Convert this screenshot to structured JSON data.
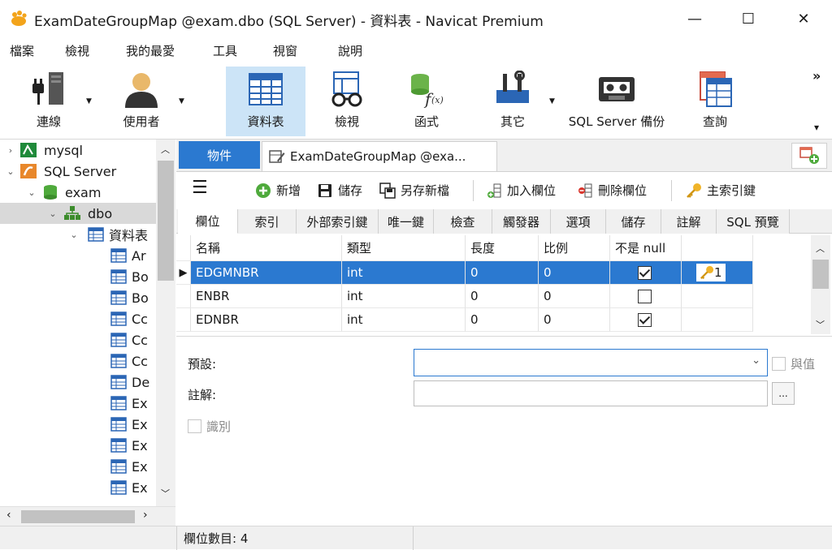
{
  "window": {
    "title": "ExamDateGroupMap @exam.dbo (SQL Server) - 資料表 - Navicat Premium",
    "minimize": "—",
    "maximize": "☐",
    "close": "✕"
  },
  "menu": [
    "檔案",
    "檢視",
    "我的最愛",
    "工具",
    "視窗",
    "說明"
  ],
  "toolbar": {
    "connect": "連線",
    "user": "使用者",
    "table": "資料表",
    "view": "檢視",
    "function": "函式",
    "other": "其它",
    "backup": "SQL Server 備份",
    "query": "查詢",
    "overflow": "»",
    "scroll_down": "▾"
  },
  "tree": {
    "items": [
      {
        "label": "mysql"
      },
      {
        "label": "SQL Server"
      },
      {
        "label": "exam"
      },
      {
        "label": "dbo"
      },
      {
        "label": "資料表"
      },
      {
        "label": "Ar"
      },
      {
        "label": "Bo"
      },
      {
        "label": "Bo"
      },
      {
        "label": "Cc"
      },
      {
        "label": "Cc"
      },
      {
        "label": "Cc"
      },
      {
        "label": "De"
      },
      {
        "label": "Ex"
      },
      {
        "label": "Ex"
      },
      {
        "label": "Ex"
      },
      {
        "label": "Ex"
      },
      {
        "label": "Ex"
      }
    ]
  },
  "tabs": {
    "objects": "物件",
    "design": "ExamDateGroupMap @exa..."
  },
  "design_toolbar": {
    "menu": "☰",
    "new": "新增",
    "save": "儲存",
    "save_as": "另存新檔",
    "add_field": "加入欄位",
    "delete_field": "刪除欄位",
    "primary_key": "主索引鍵"
  },
  "subtabs": [
    "欄位",
    "索引",
    "外部索引鍵",
    "唯一鍵",
    "檢查",
    "觸發器",
    "選項",
    "儲存",
    "註解",
    "SQL 預覽"
  ],
  "grid": {
    "headers": {
      "name": "名稱",
      "type": "類型",
      "length": "長度",
      "scale": "比例",
      "notnull": "不是 null"
    },
    "rows": [
      {
        "name": "EDGMNBR",
        "type": "int",
        "length": "0",
        "scale": "0",
        "notnull": true,
        "key": "1"
      },
      {
        "name": "ENBR",
        "type": "int",
        "length": "0",
        "scale": "0",
        "notnull": false,
        "key": ""
      },
      {
        "name": "EDNBR",
        "type": "int",
        "length": "0",
        "scale": "0",
        "notnull": true,
        "key": ""
      }
    ]
  },
  "props": {
    "default_label": "預設:",
    "comment_label": "註解:",
    "identity_label": "識別",
    "and_value_label": "與值",
    "dots": "..."
  },
  "status": {
    "field_count": "欄位數目: 4"
  },
  "colors": {
    "accent": "#2b79d0",
    "selection": "#cce4f7"
  }
}
